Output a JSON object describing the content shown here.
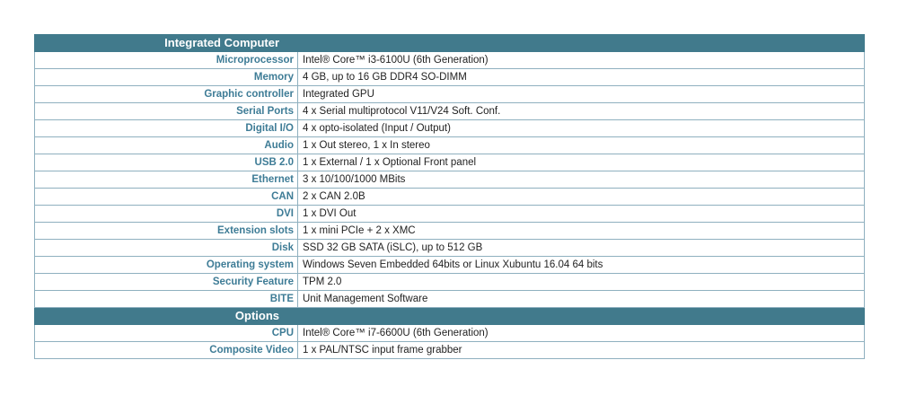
{
  "colors": {
    "header_background": "#417a8c",
    "header_text": "#ffffff",
    "label_text": "#3e7c96",
    "value_text": "#222222",
    "border": "#8fb0bf"
  },
  "sections": [
    {
      "title": "Integrated Computer",
      "rows": [
        {
          "label": "Microprocessor",
          "value": "Intel® Core™ i3-6100U (6th Generation)"
        },
        {
          "label": "Memory",
          "value": "4 GB, up to 16 GB DDR4 SO-DIMM"
        },
        {
          "label": "Graphic controller",
          "value": "Integrated GPU"
        },
        {
          "label": "Serial Ports",
          "value": "4 x Serial multiprotocol V11/V24 Soft. Conf."
        },
        {
          "label": "Digital I/O",
          "value": "4 x opto-isolated (Input / Output)"
        },
        {
          "label": "Audio",
          "value": "1 x Out stereo, 1 x In stereo"
        },
        {
          "label": "USB 2.0",
          "value": "1 x External / 1 x Optional Front panel"
        },
        {
          "label": "Ethernet",
          "value": "3 x 10/100/1000 MBits"
        },
        {
          "label": "CAN",
          "value": "2 x CAN 2.0B"
        },
        {
          "label": "DVI",
          "value": "1 x DVI Out"
        },
        {
          "label": "Extension slots",
          "value": "1 x mini PCIe + 2 x XMC"
        },
        {
          "label": "Disk",
          "value": "SSD 32 GB SATA (iSLC), up to 512 GB"
        },
        {
          "label": "Operating system",
          "value": "Windows Seven Embedded 64bits or Linux Xubuntu 16.04 64 bits"
        },
        {
          "label": "Security Feature",
          "value": "TPM 2.0"
        },
        {
          "label": "BITE",
          "value": "Unit Management Software"
        }
      ]
    },
    {
      "title": "Options",
      "rows": [
        {
          "label": "CPU",
          "value": "Intel® Core™ i7-6600U (6th Generation)"
        },
        {
          "label": "Composite Video",
          "value": "1 x PAL/NTSC input frame grabber"
        }
      ]
    }
  ]
}
